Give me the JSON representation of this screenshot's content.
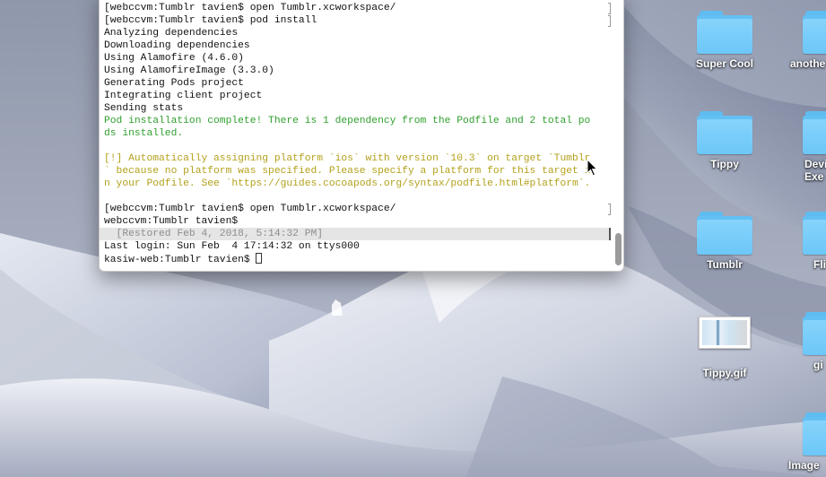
{
  "terminal": {
    "lines": [
      {
        "text": "[webccvm:Tumblr tavien$ open Tumblr.xcworkspace/",
        "style": "normal",
        "right_mark": true
      },
      {
        "text": "[webccvm:Tumblr tavien$ pod install",
        "style": "normal",
        "right_mark": true
      },
      {
        "text": "Analyzing dependencies",
        "style": "normal"
      },
      {
        "text": "Downloading dependencies",
        "style": "normal"
      },
      {
        "text": "Using Alamofire (4.6.0)",
        "style": "normal"
      },
      {
        "text": "Using AlamofireImage (3.3.0)",
        "style": "normal"
      },
      {
        "text": "Generating Pods project",
        "style": "normal"
      },
      {
        "text": "Integrating client project",
        "style": "normal"
      },
      {
        "text": "Sending stats",
        "style": "normal"
      },
      {
        "text": "Pod installation complete! There is 1 dependency from the Podfile and 2 total po",
        "style": "green"
      },
      {
        "text": "ds installed.",
        "style": "green"
      },
      {
        "text": "",
        "style": "normal"
      },
      {
        "text": "[!] Automatically assigning platform `ios` with version `10.3` on target `Tumblr",
        "style": "yellow"
      },
      {
        "text": "` because no platform was specified. Please specify a platform for this target i",
        "style": "yellow"
      },
      {
        "text": "n your Podfile. See `https://guides.cocoapods.org/syntax/podfile.html#platform`.",
        "style": "yellow"
      },
      {
        "text": "",
        "style": "normal"
      },
      {
        "text": "[webccvm:Tumblr tavien$ open Tumblr.xcworkspace/",
        "style": "normal",
        "right_mark": true
      },
      {
        "text": "webccvm:Tumblr tavien$",
        "style": "normal"
      },
      {
        "text": "  [Restored Feb 4, 2018, 5:14:32 PM]",
        "style": "restored"
      },
      {
        "text": "Last login: Sun Feb  4 17:14:32 on ttys000",
        "style": "normal"
      },
      {
        "text": "kasiw-web:Tumblr tavien$ ",
        "style": "prompt"
      }
    ]
  },
  "desktop": {
    "icons": [
      {
        "label": "Super Cool",
        "kind": "folder"
      },
      {
        "label": "anothe",
        "kind": "folder"
      },
      {
        "label": "Tippy",
        "kind": "folder"
      },
      {
        "label": "Devi\nExe",
        "kind": "folder"
      },
      {
        "label": "Tumblr",
        "kind": "folder"
      },
      {
        "label": "Fli",
        "kind": "folder"
      },
      {
        "label": "Tippy.gif",
        "kind": "gif-file"
      },
      {
        "label": "gi",
        "kind": "folder"
      },
      {
        "label": "Image",
        "kind": "folder"
      }
    ]
  },
  "colors": {
    "terminal_green": "#2f9f2f",
    "terminal_yellow": "#b3a11b",
    "folder_blue": "#6cc7f8"
  }
}
